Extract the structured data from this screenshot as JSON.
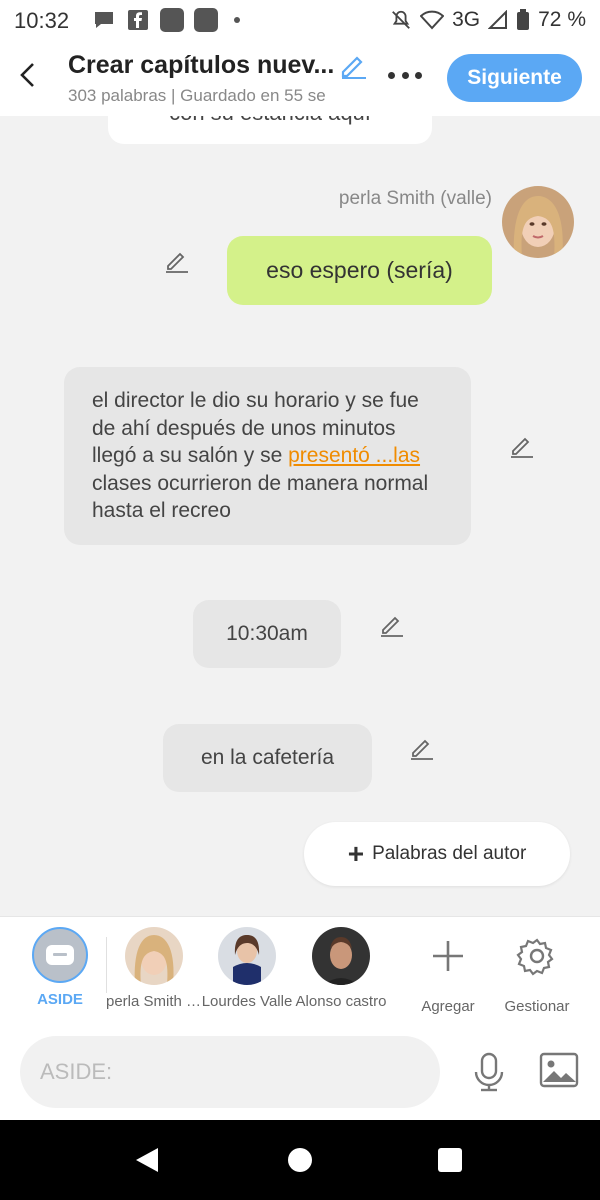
{
  "status": {
    "time": "10:32",
    "net": "3G",
    "battery": "72 %"
  },
  "header": {
    "title": "Crear capítulos nuev...",
    "subtitle": "303 palabras | Guardado en 55 se",
    "next_label": "Siguiente"
  },
  "chat": {
    "top_cut_text": "con su estancia aquí",
    "author_name": "perla Smith (valle)",
    "green_message": "eso espero (sería)",
    "narration": {
      "part1": "el director le dio su horario y se fue de ahí después de unos minutos llegó a su salón y se ",
      "highlight": "presentó ...las",
      "part2": " clases ocurrieron de manera normal hasta el recreo"
    },
    "time_message": "10:30am",
    "place_message": "en la cafetería",
    "add_words_label": "Palabras del autor"
  },
  "characters": [
    {
      "label": "ASIDE"
    },
    {
      "label": "perla Smith (valle)"
    },
    {
      "label": "Lourdes Valle"
    },
    {
      "label": "Alonso castro"
    },
    {
      "label": "Agregar"
    },
    {
      "label": "Gestionar"
    }
  ],
  "input": {
    "placeholder": "ASIDE:"
  },
  "colors": {
    "accent": "#5ba8f4",
    "green_bubble": "#d4f18a",
    "highlight": "#f08c00"
  }
}
